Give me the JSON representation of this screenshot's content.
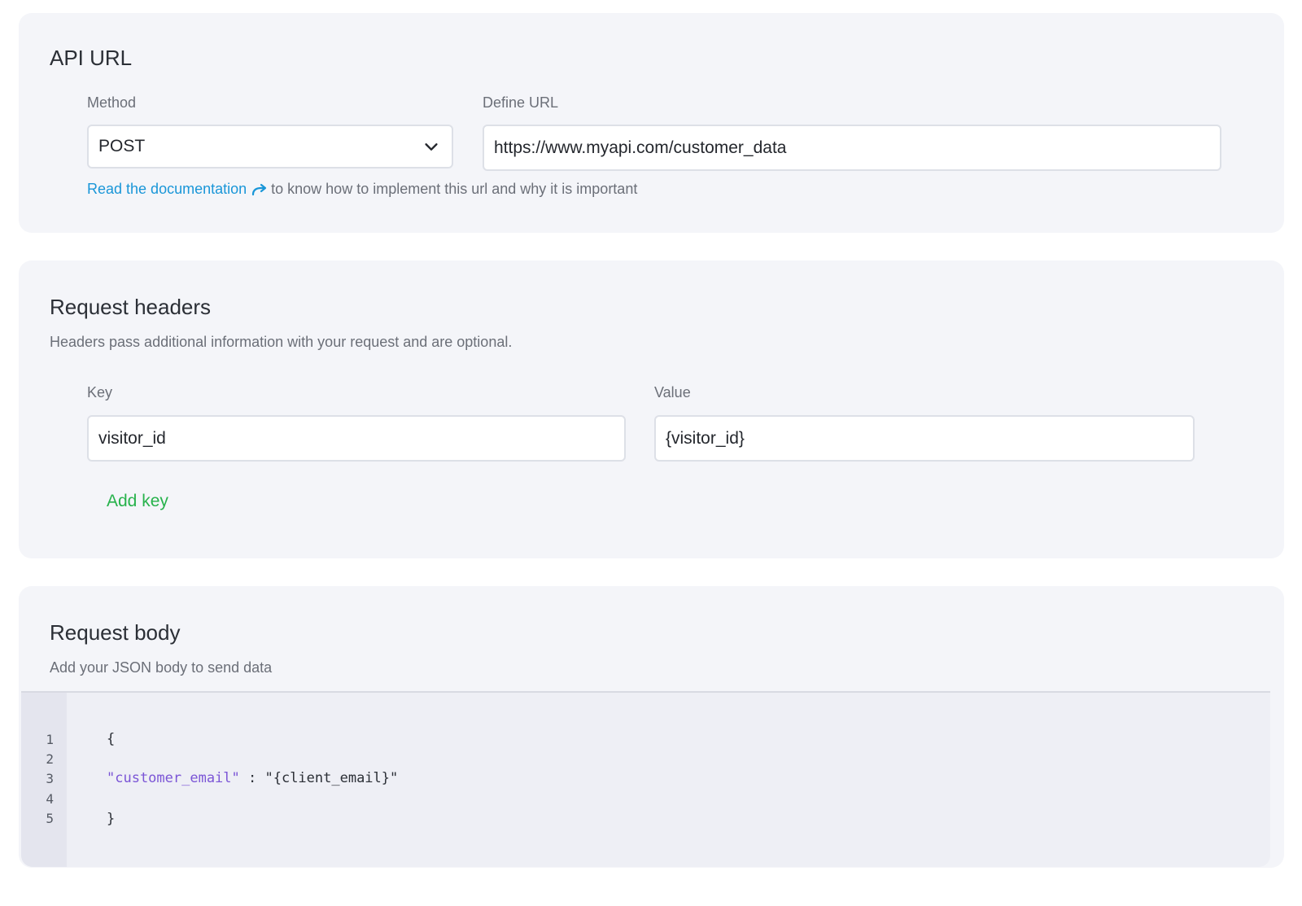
{
  "api_url": {
    "title": "API URL",
    "method_label": "Method",
    "method_value": "POST",
    "url_label": "Define URL",
    "url_value": "https://www.myapi.com/customer_data",
    "doc_link": "Read the documentation",
    "doc_text": "to know how to implement this url and why it is important"
  },
  "headers": {
    "title": "Request headers",
    "description": "Headers pass additional information with your request and are optional.",
    "key_label": "Key",
    "value_label": "Value",
    "key_value": "visitor_id",
    "value_value": "{visitor_id}",
    "add_key": "Add key"
  },
  "body": {
    "title": "Request body",
    "description": "Add your JSON body to send data",
    "line_numbers": [
      "1",
      "2",
      "3",
      "4",
      "5"
    ],
    "code": {
      "open": "{",
      "key": "\"customer_email\"",
      "sep": " : ",
      "value": "\"{client_email}\"",
      "close": "}"
    }
  },
  "colors": {
    "card_bg": "#f4f5f9",
    "link": "#1996d8",
    "add_key": "#27b24c",
    "json_key": "#7b55d6"
  },
  "icons": [
    "chevron-down-icon",
    "arrow-forward-icon"
  ]
}
